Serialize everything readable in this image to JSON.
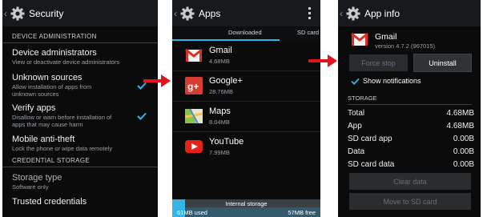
{
  "security": {
    "title": "Security",
    "sections": {
      "device_admin": "DEVICE ADMINISTRATION",
      "credential_storage": "CREDENTIAL STORAGE"
    },
    "items": [
      {
        "title": "Device administrators",
        "summary": "View or deactivate device administrators"
      },
      {
        "title": "Unknown sources",
        "summary": "Allow installation of apps from unknown sources"
      },
      {
        "title": "Verify apps",
        "summary": "Disallow or warn before installation of apps that may cause harm"
      },
      {
        "title": "Mobile anti-theft",
        "summary": "Lock the phone or wipe data remotely"
      },
      {
        "title": "Storage type",
        "summary": "Software only"
      },
      {
        "title": "Trusted credentials"
      }
    ],
    "checked": {
      "unknown_sources": true,
      "verify_apps": true
    }
  },
  "apps": {
    "title": "Apps",
    "tabs": {
      "downloaded": "Downloaded",
      "sdcard": "SD card"
    },
    "list": [
      {
        "name": "Gmail",
        "size": "4.68MB",
        "icon": "gmail-icon"
      },
      {
        "name": "Google+",
        "size": "28.76MB",
        "icon": "google-plus-icon"
      },
      {
        "name": "Maps",
        "size": "8.04MB",
        "icon": "maps-icon"
      },
      {
        "name": "YouTube",
        "size": "7.99MB",
        "icon": "youtube-icon"
      }
    ],
    "storage": {
      "label": "Internal storage",
      "used": "61MB used",
      "free": "57MB free"
    }
  },
  "app_info": {
    "title": "App info",
    "app_name": "Gmail",
    "version": "version 4.7.2 (967015)",
    "buttons": {
      "force_stop": "Force stop",
      "uninstall": "Uninstall",
      "clear_data": "Clear data",
      "move_sd": "Move to SD card"
    },
    "show_notifications": "Show notifications",
    "storage_header": "STORAGE",
    "rows": [
      {
        "label": "Total",
        "value": "4.68MB"
      },
      {
        "label": "App",
        "value": "4.68MB"
      },
      {
        "label": "SD card app",
        "value": "0.00B"
      },
      {
        "label": "Data",
        "value": "0.00B"
      },
      {
        "label": "SD card data",
        "value": "0.00B"
      }
    ]
  },
  "colors": {
    "accent": "#33b5e5",
    "arrow": "#e4141b",
    "background": "#0b0b0b"
  }
}
